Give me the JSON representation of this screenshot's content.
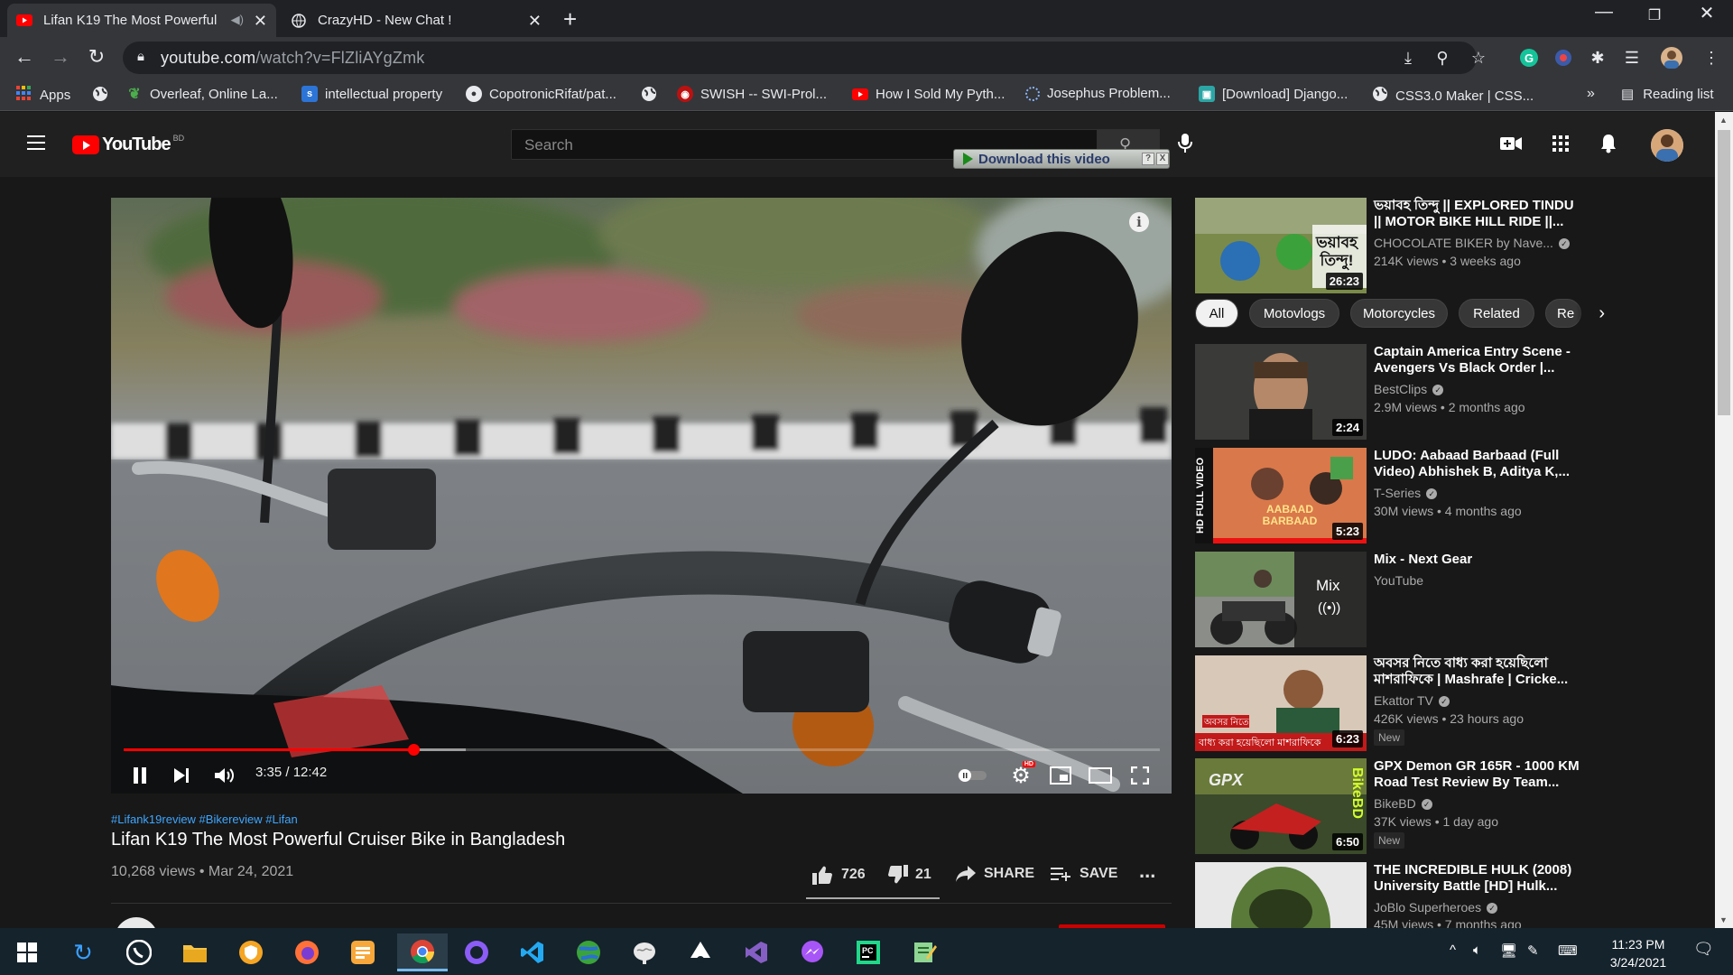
{
  "browser": {
    "tabs": [
      {
        "title": "Lifan K19 The Most Powerful",
        "active": true
      },
      {
        "title": "CrazyHD - New Chat !",
        "active": false
      }
    ],
    "address": {
      "domain": "youtube.com",
      "path": "/watch?v=FlZliAYgZmk"
    },
    "bookmarks": [
      {
        "label": "Apps",
        "icon": "apps-grid-icon"
      },
      {
        "label": "",
        "icon": "globe-icon"
      },
      {
        "label": "Overleaf, Online La...",
        "icon": "overleaf-icon"
      },
      {
        "label": "intellectual property",
        "icon": "s-icon"
      },
      {
        "label": "CopotronicRifat/pat...",
        "icon": "github-icon"
      },
      {
        "label": "",
        "icon": "globe-icon"
      },
      {
        "label": "SWISH -- SWI-Prol...",
        "icon": "swish-icon"
      },
      {
        "label": "How I Sold My Pyth...",
        "icon": "youtube-icon"
      },
      {
        "label": "Josephus Problem...",
        "icon": "loading-icon"
      },
      {
        "label": "[Download] Django...",
        "icon": "django-icon"
      },
      {
        "label": "CSS3.0 Maker | CSS...",
        "icon": "globe-icon"
      }
    ],
    "overflow_label": "»",
    "reading_list": "Reading list"
  },
  "youtube": {
    "logo_word": "YouTube",
    "region": "BD",
    "search_placeholder": "Search",
    "download_button": "Download this video",
    "download_help": "?",
    "download_close": "X"
  },
  "player": {
    "time": "3:35 / 12:42",
    "progress": 0.28,
    "buffered": 0.33,
    "info": "i"
  },
  "video": {
    "hashtags": "#Lifank19review #Bikereview #Lifan",
    "title": "Lifan K19 The Most Powerful Cruiser Bike in Bangladesh",
    "views_date": "10,268 views • Mar 24, 2021",
    "likes": "726",
    "dislikes": "21",
    "share": "SHARE",
    "save": "SAVE",
    "more": "..."
  },
  "chips": [
    "All",
    "Motovlogs",
    "Motorcycles",
    "Related",
    "Re"
  ],
  "sidebar": [
    {
      "title1": "ভয়াবহ তিন্দু || EXPLORED TINDU",
      "title2": "|| MOTOR BIKE HILL RIDE ||...",
      "channel": "CHOCOLATE BIKER by Nave...",
      "verified": true,
      "meta": "214K views • 3 weeks ago",
      "duration": "26:23",
      "new": ""
    },
    {
      "title1": "Captain America Entry Scene -",
      "title2": "Avengers Vs Black Order |...",
      "channel": "BestClips",
      "verified": true,
      "meta": "2.9M views • 2 months ago",
      "duration": "2:24",
      "new": ""
    },
    {
      "title1": "LUDO: Aabaad Barbaad (Full",
      "title2": "Video) Abhishek B, Aditya K,...",
      "channel": "T-Series",
      "verified": true,
      "meta": "30M views • 4 months ago",
      "duration": "5:23",
      "new": ""
    },
    {
      "title1": "Mix - Next Gear",
      "title2": "",
      "channel": "YouTube",
      "verified": false,
      "meta": "",
      "duration": "",
      "new": ""
    },
    {
      "title1": "অবসর নিতে বাধ্য করা হয়েছিলো",
      "title2": "মাশরাফিকে | Mashrafe | Cricke...",
      "channel": "Ekattor TV",
      "verified": true,
      "meta": "426K views • 23 hours ago",
      "duration": "6:23",
      "new": "New"
    },
    {
      "title1": "GPX Demon GR 165R - 1000 KM",
      "title2": "Road Test Review By Team...",
      "channel": "BikeBD",
      "verified": true,
      "meta": "37K views • 1 day ago",
      "duration": "6:50",
      "new": "New"
    },
    {
      "title1": "THE INCREDIBLE HULK (2008)",
      "title2": "University Battle [HD] Hulk...",
      "channel": "JoBlo Superheroes",
      "verified": true,
      "meta": "45M views • 7 months ago",
      "duration": "",
      "new": ""
    }
  ],
  "thumb_text": {
    "tindu": "ভয়াবহ তিন্দু!",
    "ludo_side": "HD FULL VIDEO",
    "ludo_title": "AABAAD BARBAAD",
    "mix": "Mix",
    "ekattor_banner": "বাধ্য করা হয়েছিলো মাশরাফিকে",
    "ekattor_top": "অবসর নিতে",
    "gpx_side": "BikeBD"
  },
  "taskbar": {
    "time": "11:23 PM",
    "date": "3/24/2021"
  }
}
